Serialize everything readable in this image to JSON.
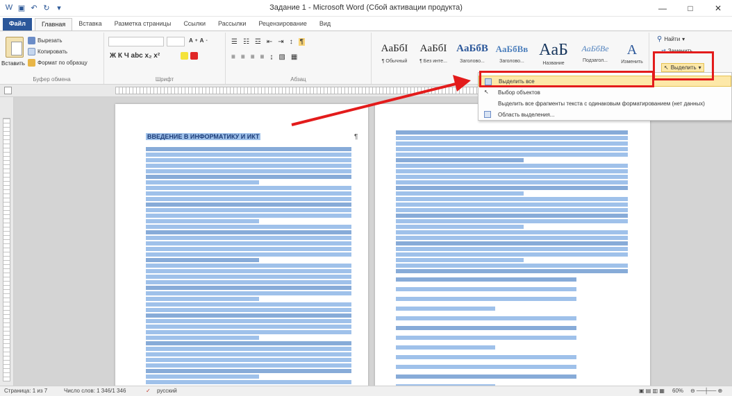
{
  "window": {
    "title": "Задание 1 - Microsoft Word (Сбой активации продукта)",
    "minimize": "—",
    "maximize": "□",
    "close": "✕"
  },
  "tabs": [
    {
      "label": "Файл"
    },
    {
      "label": "Главная"
    },
    {
      "label": "Вставка"
    },
    {
      "label": "Разметка страницы"
    },
    {
      "label": "Ссылки"
    },
    {
      "label": "Рассылки"
    },
    {
      "label": "Рецензирование"
    },
    {
      "label": "Вид"
    }
  ],
  "clipboard": {
    "paste": "Вставить",
    "cut": "Вырезать",
    "copy": "Копировать",
    "format_painter": "Формат по образцу",
    "group_label": "Буфер обмена"
  },
  "font": {
    "group_label": "Шрифт",
    "format_buttons": "Ж К Ч  abc x₂ x²"
  },
  "paragraph": {
    "group_label": "Абзац"
  },
  "styles": {
    "items": [
      {
        "sample": "AaБбI",
        "name": "¶ Обычный"
      },
      {
        "sample": "AaБбI",
        "name": "¶ Без инте..."
      },
      {
        "sample": "AaБбВ",
        "name": "Заголово..."
      },
      {
        "sample": "AaБбВв",
        "name": "Заголово..."
      },
      {
        "sample": "AaБ",
        "name": "Название"
      },
      {
        "sample": "AaБбВе",
        "name": "Подзагол..."
      }
    ],
    "change": "Изменить"
  },
  "editing": {
    "find": "Найти",
    "replace": "Заменить",
    "select": "Выделить"
  },
  "select_menu": {
    "items": [
      {
        "label": "Выделить все"
      },
      {
        "label": "Выбор объектов"
      },
      {
        "label": "Выделить все фрагменты текста с одинаковым форматированием (нет данных)"
      },
      {
        "label": "Область выделения..."
      }
    ]
  },
  "document": {
    "heading": "ВВЕДЕНИЕ В ИНФОРМАТИКУ И ИКТ",
    "pilcrow": "¶"
  },
  "status": {
    "page": "Страница: 1 из 7",
    "words": "Число слов: 1 346/1 346",
    "language": "русский",
    "zoom": "60%"
  },
  "colors": {
    "selection": "#9fc1ea",
    "accent": "#2b579a",
    "highlight_red": "#e31b1b"
  }
}
